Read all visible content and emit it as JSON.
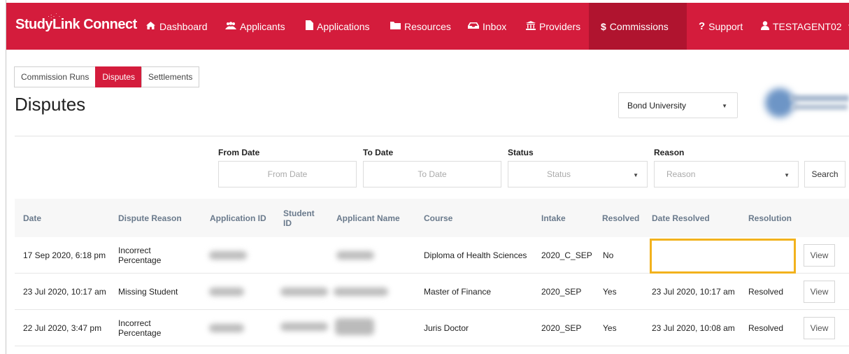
{
  "brand": {
    "name": "StudyLink Connect",
    "sparkle": "·:·˙·"
  },
  "nav": {
    "items": [
      {
        "label": "Dashboard",
        "icon": "home-icon"
      },
      {
        "label": "Applicants",
        "icon": "users-icon"
      },
      {
        "label": "Applications",
        "icon": "file-icon"
      },
      {
        "label": "Resources",
        "icon": "folder-icon"
      },
      {
        "label": "Inbox",
        "icon": "inbox-icon"
      },
      {
        "label": "Providers",
        "icon": "institution-icon"
      },
      {
        "label": "Commissions",
        "icon": "dollar-icon",
        "active": true
      },
      {
        "label": "Support",
        "icon": "question-icon"
      },
      {
        "label": "TESTAGENT02",
        "icon": "user-icon"
      }
    ]
  },
  "subtabs": [
    "Commission Runs",
    "Disputes",
    "Settlements"
  ],
  "page": {
    "title": "Disputes"
  },
  "provider": {
    "selected": "Bond University"
  },
  "filters": {
    "from_date": {
      "label": "From Date",
      "placeholder": "From Date"
    },
    "to_date": {
      "label": "To Date",
      "placeholder": "To Date"
    },
    "status": {
      "label": "Status",
      "placeholder": "Status"
    },
    "reason": {
      "label": "Reason",
      "placeholder": "Reason"
    },
    "search_label": "Search"
  },
  "table": {
    "columns": [
      "Date",
      "Dispute Reason",
      "Application ID",
      "Student ID",
      "Applicant Name",
      "Course",
      "Intake",
      "Resolved",
      "Date Resolved",
      "Resolution"
    ],
    "rows": [
      {
        "date": "17 Sep 2020, 6:18 pm",
        "reason": "Incorrect Percentage",
        "course": "Diploma of Health Sciences",
        "intake": "2020_C_SEP",
        "resolved": "No",
        "date_resolved": "",
        "resolution": "",
        "action": "View"
      },
      {
        "date": "23 Jul 2020, 10:17 am",
        "reason": "Missing Student",
        "course": "Master of Finance",
        "intake": "2020_SEP",
        "resolved": "Yes",
        "date_resolved": "23 Jul 2020, 10:17 am",
        "resolution": "Resolved",
        "action": "View"
      },
      {
        "date": "22 Jul 2020, 3:47 pm",
        "reason": "Incorrect Percentage",
        "course": "Juris Doctor",
        "intake": "2020_SEP",
        "resolved": "Yes",
        "date_resolved": "23 Jul 2020, 10:08 am",
        "resolution": "Resolved",
        "action": "View"
      }
    ]
  },
  "colors": {
    "brand": "#d41c3c",
    "active_nav": "#b0142f",
    "highlight": "#f2b21d"
  }
}
